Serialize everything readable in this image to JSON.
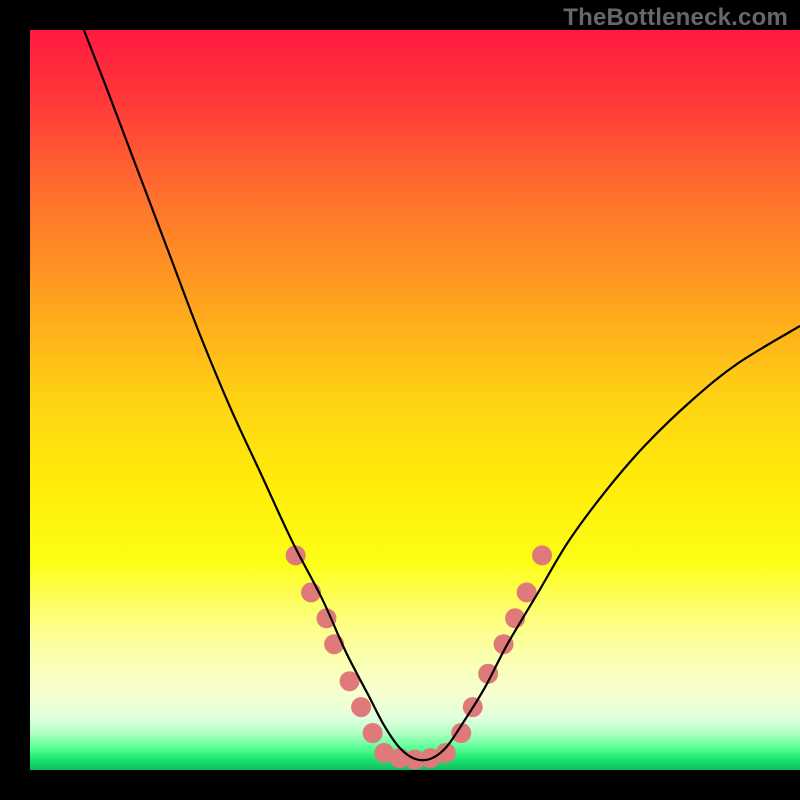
{
  "watermark": "TheBottleneck.com",
  "chart_data": {
    "type": "line",
    "title": "",
    "xlabel": "",
    "ylabel": "",
    "xlim": [
      0,
      100
    ],
    "ylim": [
      0,
      100
    ],
    "grid": false,
    "legend": false,
    "background": "rainbow-vertical",
    "series": [
      {
        "name": "bottleneck-curve",
        "color": "#000000",
        "x": [
          7,
          10,
          14,
          18,
          22,
          26,
          30,
          34,
          38,
          41,
          44,
          46,
          48,
          50,
          52,
          54,
          56,
          59,
          62,
          66,
          70,
          75,
          80,
          86,
          92,
          100
        ],
        "y": [
          100,
          92,
          81,
          70,
          59,
          49,
          40,
          31,
          23,
          16,
          10,
          6,
          3,
          1.5,
          1.5,
          3,
          6,
          11,
          17,
          24,
          31,
          38,
          44,
          50,
          55,
          60
        ]
      }
    ],
    "annotations": {
      "scatter_markers": {
        "color": "#e07a7a",
        "radius": 10,
        "points": [
          {
            "x": 34.5,
            "y": 29
          },
          {
            "x": 36.5,
            "y": 24
          },
          {
            "x": 38.5,
            "y": 20.5
          },
          {
            "x": 39.5,
            "y": 17
          },
          {
            "x": 41.5,
            "y": 12
          },
          {
            "x": 43.0,
            "y": 8.5
          },
          {
            "x": 44.5,
            "y": 5
          },
          {
            "x": 46.0,
            "y": 2.3
          },
          {
            "x": 48.0,
            "y": 1.6
          },
          {
            "x": 50.0,
            "y": 1.4
          },
          {
            "x": 52.0,
            "y": 1.6
          },
          {
            "x": 54.0,
            "y": 2.3
          },
          {
            "x": 56.0,
            "y": 5
          },
          {
            "x": 57.5,
            "y": 8.5
          },
          {
            "x": 59.5,
            "y": 13
          },
          {
            "x": 61.5,
            "y": 17
          },
          {
            "x": 63.0,
            "y": 20.5
          },
          {
            "x": 64.5,
            "y": 24
          },
          {
            "x": 66.5,
            "y": 29
          }
        ]
      }
    }
  }
}
